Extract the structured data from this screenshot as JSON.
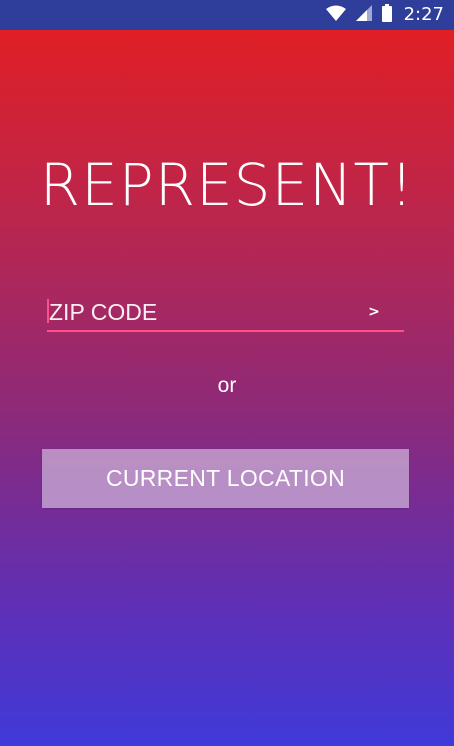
{
  "status_bar": {
    "time": "2:27",
    "icons": [
      "wifi-icon",
      "cell-signal-icon",
      "battery-icon"
    ],
    "color": "#2f3e9b"
  },
  "app": {
    "title": "REPRESENT!"
  },
  "zip": {
    "placeholder": "ZIP CODE",
    "value": "",
    "submit_label": ">",
    "accent_color": "#ff4f86"
  },
  "divider_text": "or",
  "location_button": {
    "label": "CURRENT LOCATION"
  },
  "colors": {
    "gradient_top": "#e01f25",
    "gradient_bottom": "#3f3ad9"
  }
}
